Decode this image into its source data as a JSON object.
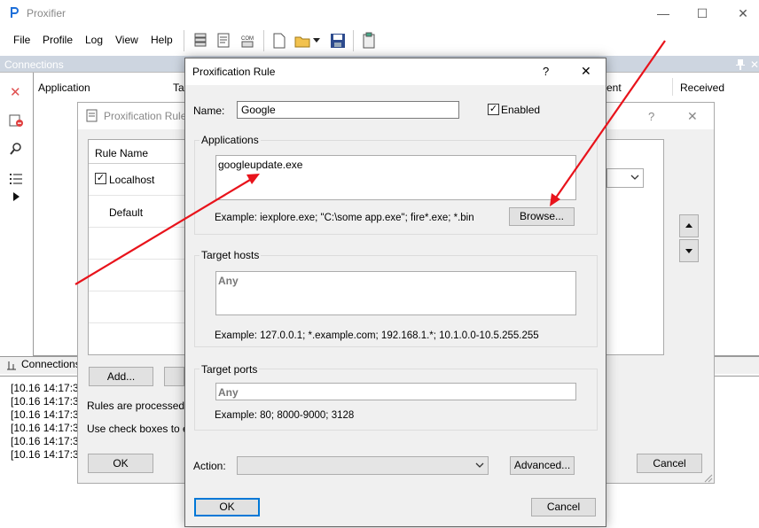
{
  "app": {
    "title": "Proxifier"
  },
  "window_controls": {
    "minimize": "—",
    "maximize": "☐",
    "close": "✕"
  },
  "menu": [
    "File",
    "Profile",
    "Log",
    "View",
    "Help"
  ],
  "connections_panel": {
    "title": "Connections",
    "columns": [
      "Application",
      "Ta",
      "ent",
      "Received"
    ],
    "bottom_tab": "Connections"
  },
  "log": {
    "lines": [
      "[10.16 14:17:37",
      "[10.16 14:17:37",
      "[10.16 14:17:37",
      "[10.16 14:17:37",
      "[10.16 14:17:37",
      "[10.16 14:17:37"
    ]
  },
  "background_dialog": {
    "title": "Proxification Rule",
    "help": "?",
    "close": "✕",
    "list_header": "Rule Name",
    "rules": [
      {
        "name": "Localhost",
        "checked": true
      },
      {
        "name": "Default",
        "checked": false
      }
    ],
    "add_button": "Add...",
    "text1": "Rules are processed fr",
    "text2": "Use check boxes to ena",
    "ok_button": "OK",
    "cancel_button": "Cancel"
  },
  "dialog": {
    "title": "Proxification Rule",
    "help": "?",
    "close": "✕",
    "name_label": "Name:",
    "name_value": "Google",
    "enabled_label": "Enabled",
    "enabled_checked": true,
    "applications": {
      "label": "Applications",
      "value": "googleupdate.exe",
      "example": "Example: iexplore.exe; \"C:\\some app.exe\"; fire*.exe; *.bin",
      "browse_button": "Browse..."
    },
    "target_hosts": {
      "label": "Target hosts",
      "value": "Any",
      "example": "Example: 127.0.0.1; *.example.com; 192.168.1.*; 10.1.0.0-10.5.255.255"
    },
    "target_ports": {
      "label": "Target ports",
      "value": "Any",
      "example": "Example: 80; 8000-9000; 3128"
    },
    "action_label": "Action:",
    "action_value": "",
    "advanced_button": "Advanced...",
    "ok_button": "OK",
    "cancel_button": "Cancel"
  },
  "colors": {
    "accent": "#0078d7",
    "arrow": "#e8131b",
    "panel_header": "#cdd5e0"
  }
}
